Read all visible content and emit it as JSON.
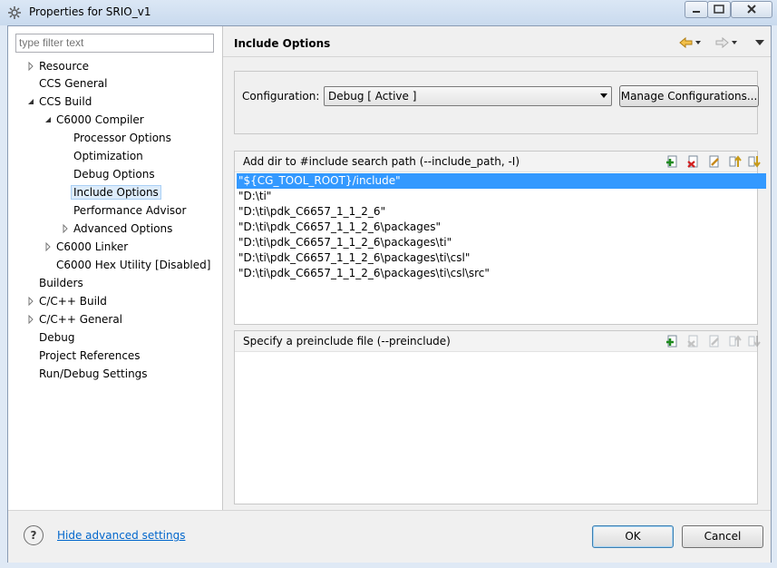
{
  "window": {
    "title": "Properties for SRIO_v1"
  },
  "sidebar": {
    "filter_placeholder": "type filter text",
    "items": [
      {
        "label": "Resource"
      },
      {
        "label": "CCS General"
      },
      {
        "label": "CCS Build"
      },
      {
        "label": "C6000 Compiler"
      },
      {
        "label": "Processor Options"
      },
      {
        "label": "Optimization"
      },
      {
        "label": "Debug Options"
      },
      {
        "label": "Include Options"
      },
      {
        "label": "Performance Advisor"
      },
      {
        "label": "Advanced Options"
      },
      {
        "label": "C6000 Linker"
      },
      {
        "label": "C6000 Hex Utility  [Disabled]"
      },
      {
        "label": "Builders"
      },
      {
        "label": "C/C++ Build"
      },
      {
        "label": "C/C++ General"
      },
      {
        "label": "Debug"
      },
      {
        "label": "Project References"
      },
      {
        "label": "Run/Debug Settings"
      }
    ]
  },
  "page": {
    "title": "Include Options",
    "config_label": "Configuration:",
    "config_value": "Debug  [ Active ]",
    "manage_button": "Manage Configurations..."
  },
  "include_panel": {
    "title": "Add dir to #include search path (--include_path, -I)",
    "entries": [
      "\"${CG_TOOL_ROOT}/include\"",
      "\"D:\\ti\"",
      "\"D:\\ti\\pdk_C6657_1_1_2_6\"",
      "\"D:\\ti\\pdk_C6657_1_1_2_6\\packages\"",
      "\"D:\\ti\\pdk_C6657_1_1_2_6\\packages\\ti\"",
      "\"D:\\ti\\pdk_C6657_1_1_2_6\\packages\\ti\\csl\"",
      "\"D:\\ti\\pdk_C6657_1_1_2_6\\packages\\ti\\csl\\src\""
    ]
  },
  "preinclude_panel": {
    "title": "Specify a preinclude file (--preinclude)"
  },
  "footer": {
    "help_glyph": "?",
    "hide_advanced": "Hide advanced settings",
    "ok": "OK",
    "cancel": "Cancel"
  },
  "colors": {
    "selection": "#3399ff",
    "link": "#0066cc",
    "tree_selection": "#ddecfb"
  }
}
